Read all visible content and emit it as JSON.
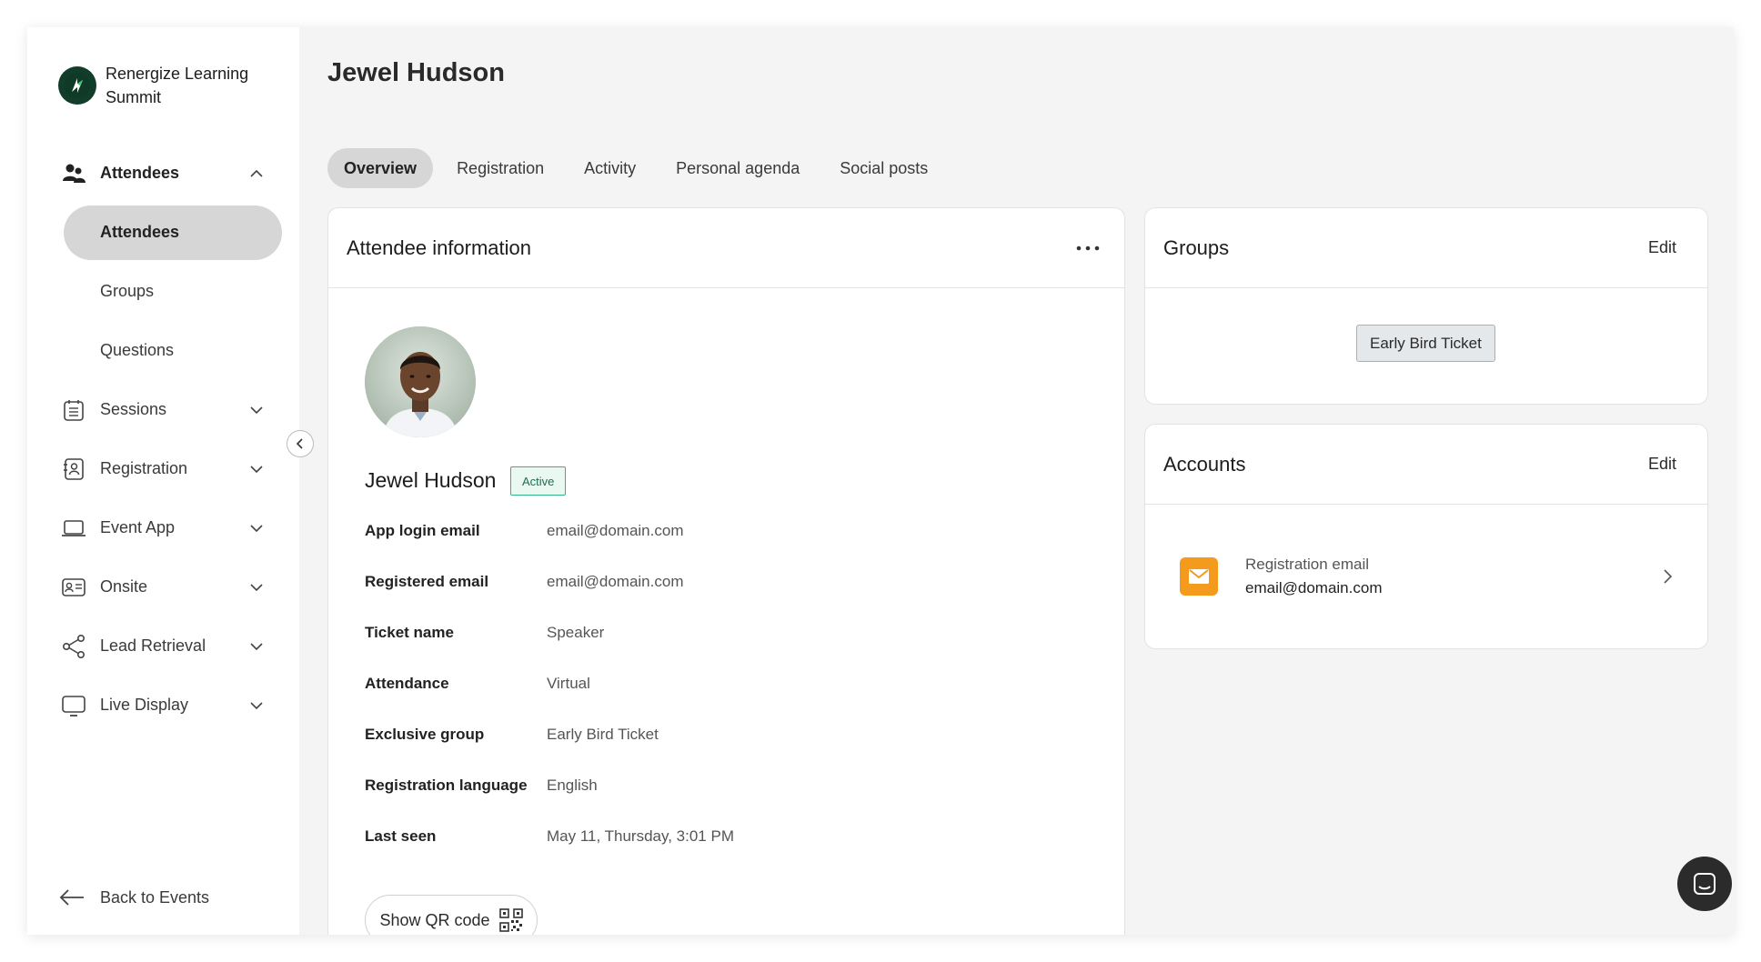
{
  "brand": {
    "name": "Renergize Learning Summit"
  },
  "sidebar": {
    "items": [
      {
        "label": "Attendees",
        "icon": "people-icon",
        "expanded": true
      },
      {
        "label": "Sessions",
        "icon": "calendar-list-icon"
      },
      {
        "label": "Registration",
        "icon": "contact-book-icon"
      },
      {
        "label": "Event App",
        "icon": "laptop-icon"
      },
      {
        "label": "Onsite",
        "icon": "id-card-icon"
      },
      {
        "label": "Lead Retrieval",
        "icon": "share-icon"
      },
      {
        "label": "Live Display",
        "icon": "monitor-icon"
      }
    ],
    "subitems": [
      "Attendees",
      "Groups",
      "Questions"
    ],
    "active_subitem": "Attendees",
    "back_label": "Back to Events"
  },
  "page": {
    "title": "Jewel Hudson"
  },
  "tabs": [
    "Overview",
    "Registration",
    "Activity",
    "Personal agenda",
    "Social posts"
  ],
  "active_tab": "Overview",
  "attendee_card": {
    "title": "Attendee information",
    "name": "Jewel Hudson",
    "status": "Active",
    "fields": [
      {
        "label": "App login email",
        "value": "email@domain.com"
      },
      {
        "label": "Registered email",
        "value": "email@domain.com"
      },
      {
        "label": "Ticket name",
        "value": "Speaker"
      },
      {
        "label": "Attendance",
        "value": "Virtual"
      },
      {
        "label": "Exclusive group",
        "value": "Early Bird Ticket"
      },
      {
        "label": "Registration language",
        "value": "English"
      },
      {
        "label": "Last seen",
        "value": "May 11, Thursday, 3:01 PM"
      }
    ],
    "qr_label": "Show QR code"
  },
  "groups_card": {
    "title": "Groups",
    "edit_label": "Edit",
    "chip": "Early Bird Ticket"
  },
  "accounts_card": {
    "title": "Accounts",
    "edit_label": "Edit",
    "account_label": "Registration email",
    "account_value": "email@domain.com"
  },
  "colors": {
    "accent_badge": "#33b38a",
    "mail_icon_bg": "#f49a1c",
    "active_pill": "#d6d6d6"
  }
}
